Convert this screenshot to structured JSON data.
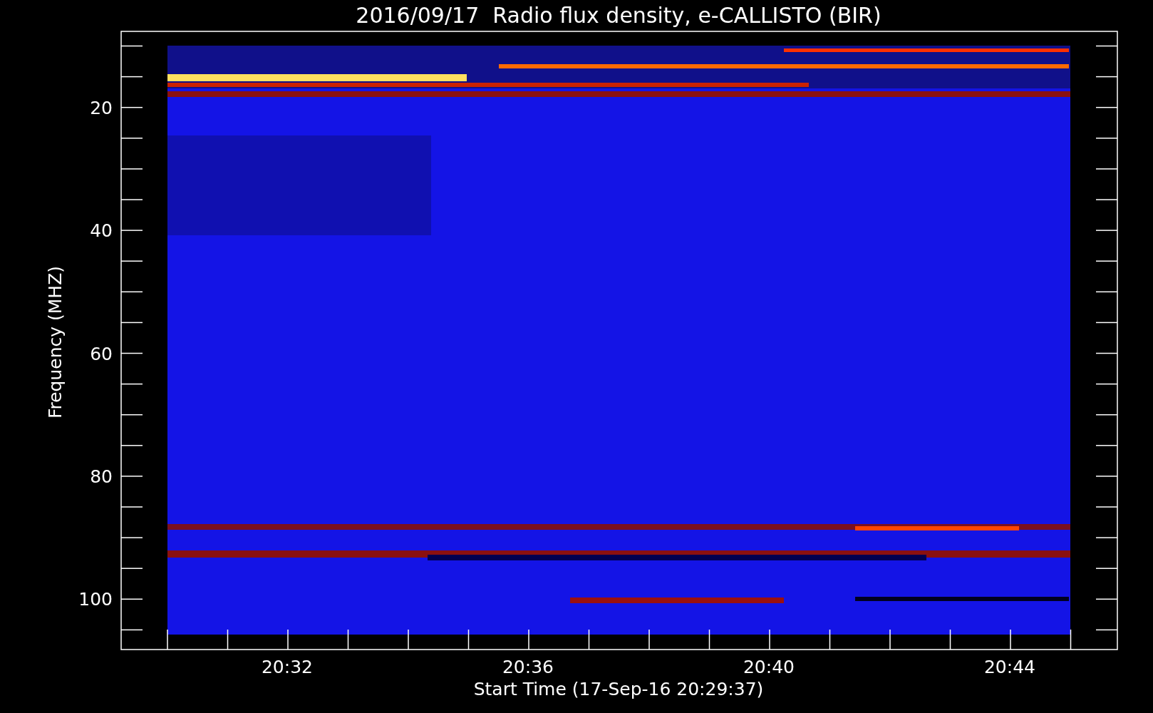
{
  "plot": {
    "title": "2016/09/17  Radio flux density, e-CALLISTO (BIR)",
    "xlabel": "Start Time (17-Sep-16 20:29:37)",
    "ylabel": "Frequency (MHZ)",
    "xtick_labels": [
      "20:32",
      "20:36",
      "20:40",
      "20:44"
    ],
    "ytick_labels": [
      "20",
      "40",
      "60",
      "80",
      "100"
    ]
  }
}
